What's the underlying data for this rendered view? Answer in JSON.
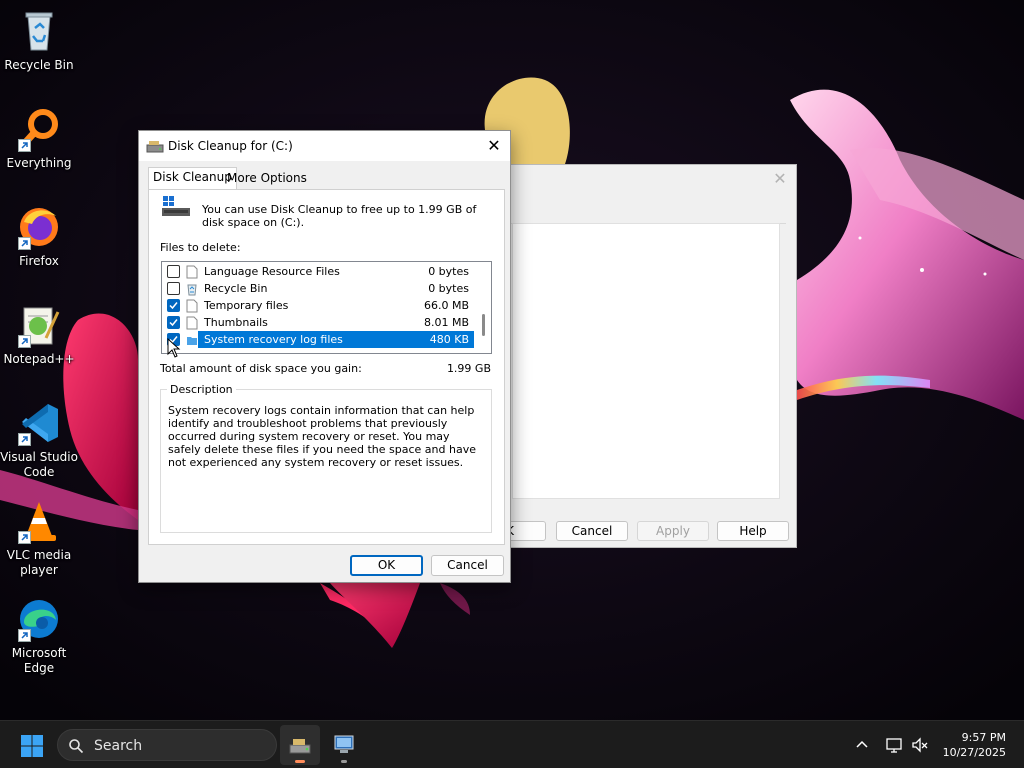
{
  "desktop": {
    "icons": [
      {
        "label": "Recycle Bin"
      },
      {
        "label": "Everything"
      },
      {
        "label": "Firefox"
      },
      {
        "label": "Notepad++"
      },
      {
        "label": "Visual Studio Code"
      },
      {
        "label": "VLC media player"
      },
      {
        "label": "Microsoft Edge"
      }
    ]
  },
  "back_window": {
    "buttons": {
      "ok": "K",
      "cancel": "Cancel",
      "apply": "Apply",
      "help": "Help"
    }
  },
  "dialog": {
    "title": "Disk Cleanup for  (C:)",
    "tabs": [
      {
        "label": "Disk Cleanup",
        "selected": true
      },
      {
        "label": "More Options",
        "selected": false
      }
    ],
    "header_text": "You can use Disk Cleanup to free up to 1.99 GB of disk space on  (C:).",
    "files_label": "Files to delete:",
    "files": [
      {
        "name": "Language Resource Files",
        "size": "0 bytes",
        "checked": false,
        "selected": false,
        "icon": "file-icon"
      },
      {
        "name": "Recycle Bin",
        "size": "0 bytes",
        "checked": false,
        "selected": false,
        "icon": "recycle-bin-icon"
      },
      {
        "name": "Temporary files",
        "size": "66.0 MB",
        "checked": true,
        "selected": false,
        "icon": "file-icon"
      },
      {
        "name": "Thumbnails",
        "size": "8.01 MB",
        "checked": true,
        "selected": false,
        "icon": "file-icon"
      },
      {
        "name": "System recovery log files",
        "size": "480 KB",
        "checked": true,
        "selected": true,
        "icon": "folder-icon"
      }
    ],
    "total_label": "Total amount of disk space you gain:",
    "total_value": "1.99 GB",
    "description_legend": "Description",
    "description_text": "System recovery logs contain information that can help identify and troubleshoot problems that previously occurred during system recovery or reset. You may safely delete these files if you need the space and have not experienced any system recovery or reset issues.",
    "ok_label": "OK",
    "cancel_label": "Cancel"
  },
  "taskbar": {
    "search_placeholder": "Search",
    "time": "9:57 PM",
    "date": "10/27/2025"
  },
  "colors": {
    "accent": "#0067c0",
    "selection": "#0078d7",
    "taskbar": "#1c1c1c"
  }
}
